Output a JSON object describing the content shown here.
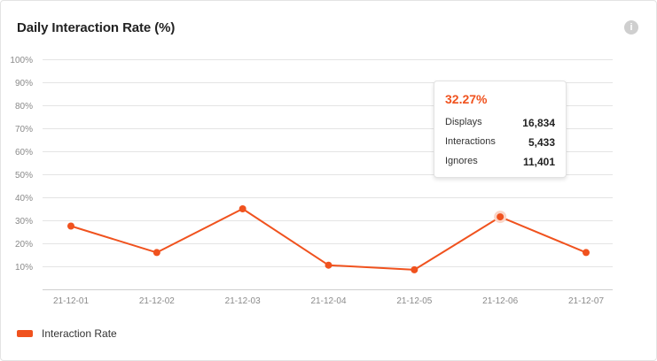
{
  "card": {
    "title": "Daily Interaction Rate (%)",
    "info_icon": "info-icon"
  },
  "tooltip": {
    "rate": "32.27%",
    "rows": [
      {
        "label": "Displays",
        "value": "16,834"
      },
      {
        "label": "Interactions",
        "value": "5,433"
      },
      {
        "label": "Ignores",
        "value": "11,401"
      }
    ]
  },
  "legend": {
    "label": "Interaction Rate"
  },
  "colors": {
    "series": "#f0521e",
    "grid": "#e4e4e4",
    "highlight": "#fbd5c7"
  },
  "chart_data": {
    "type": "line",
    "title": "Daily Interaction Rate (%)",
    "xlabel": "",
    "ylabel": "",
    "categories": [
      "21-12-01",
      "21-12-02",
      "21-12-03",
      "21-12-04",
      "21-12-05",
      "21-12-06",
      "21-12-07"
    ],
    "series": [
      {
        "name": "Interaction Rate",
        "values": [
          27.5,
          16,
          35,
          10.5,
          8.5,
          31.5,
          16
        ]
      }
    ],
    "highlighted_category": "21-12-06",
    "ylim": [
      0,
      100
    ],
    "yticks": [
      "10%",
      "20%",
      "30%",
      "40%",
      "50%",
      "60%",
      "70%",
      "80%",
      "90%",
      "100%"
    ],
    "ytick_values": [
      10,
      20,
      30,
      40,
      50,
      60,
      70,
      80,
      90,
      100
    ],
    "grid": true,
    "legend_position": "bottom-left"
  }
}
